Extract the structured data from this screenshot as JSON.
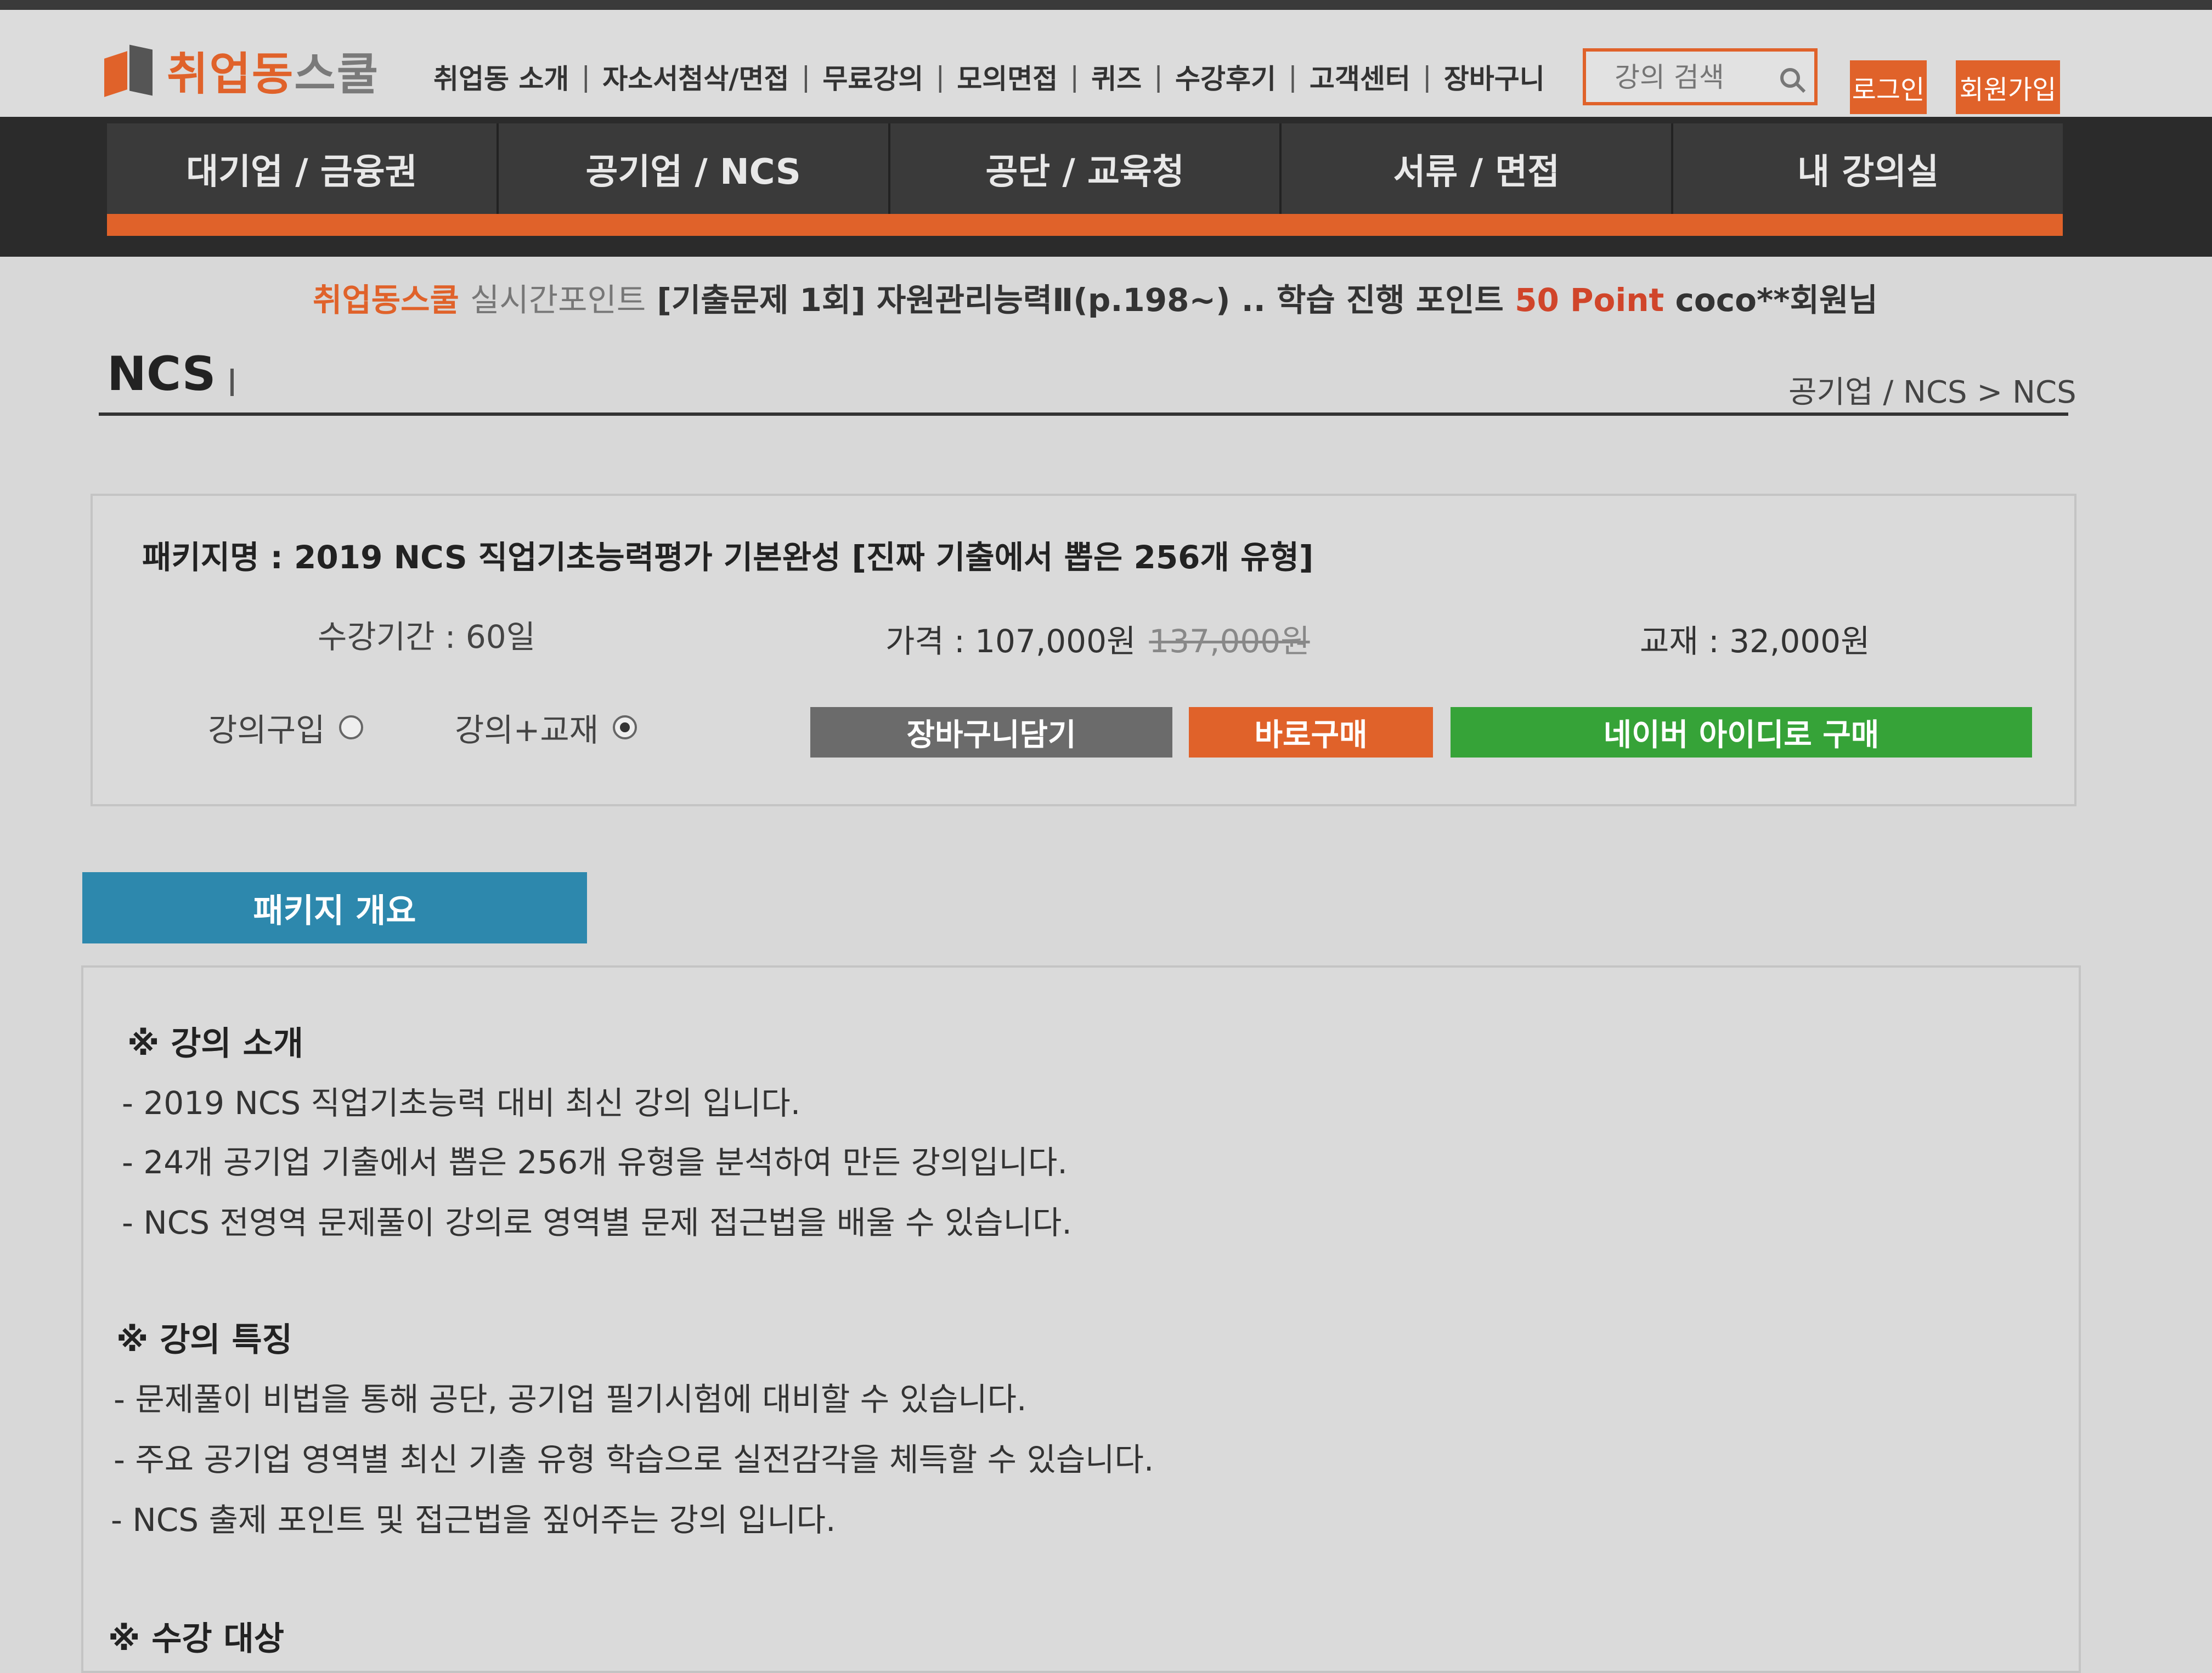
{
  "brand": {
    "name_highlight": "취업동",
    "name_rest": "스쿨"
  },
  "topnav": [
    "취업동 소개",
    "자소서첨삭/면접",
    "무료강의",
    "모의면접",
    "퀴즈",
    "수강후기",
    "고객센터",
    "장바구니"
  ],
  "search": {
    "placeholder": "강의 검색"
  },
  "auth": {
    "login": "로그인",
    "join": "회원가입"
  },
  "mainnav": [
    "대기업 / 금융권",
    "공기업 / NCS",
    "공단 / 교육청",
    "서류 / 면접",
    "내 강의실"
  ],
  "ticker": {
    "brand": "취업동스쿨",
    "label": "실시간포인트",
    "message": "[기출문제 1회] 자원관리능력Ⅱ(p.198~) .. 학습 진행 포인트",
    "points": "50 Point",
    "user": "coco**회원님"
  },
  "page": {
    "title": "NCS",
    "breadcrumb": "공기업 / NCS > NCS"
  },
  "package": {
    "name": "패키지명 : 2019 NCS 직업기초능력평가 기본완성 [진짜 기출에서 뽑은 256개 유형]",
    "period": "수강기간 : 60일",
    "price": "가격 : 107,000원",
    "original_price": "137,000원",
    "book": "교재 : 32,000원",
    "option_lecture": "강의구입",
    "option_lecture_book": "강의+교재",
    "selected_option": "강의+교재",
    "btn_cart": "장바구니담기",
    "btn_buy": "바로구매",
    "btn_naver": "네이버 아이디로 구매"
  },
  "overview": {
    "tab": "패키지 개요",
    "intro_title": "※ 강의 소개",
    "intro_lines": [
      "- 2019 NCS 직업기초능력 대비 최신 강의 입니다.",
      "- 24개 공기업 기출에서 뽑은 256개 유형을 분석하여 만든 강의입니다.",
      "- NCS 전영역 문제풀이 강의로 영역별 문제 접근법을 배울 수 있습니다."
    ],
    "feature_title": "※ 강의 특징",
    "feature_lines": [
      "- 문제풀이 비법을 통해 공단, 공기업 필기시험에 대비할 수 있습니다.",
      "- 주요 공기업 영역별 최신 기출 유형 학습으로 실전감각을 체득할 수 있습니다.",
      "- NCS 출제 포인트 및 접근법을 짚어주는 강의 입니다."
    ],
    "target_title": "※ 수강 대상"
  }
}
